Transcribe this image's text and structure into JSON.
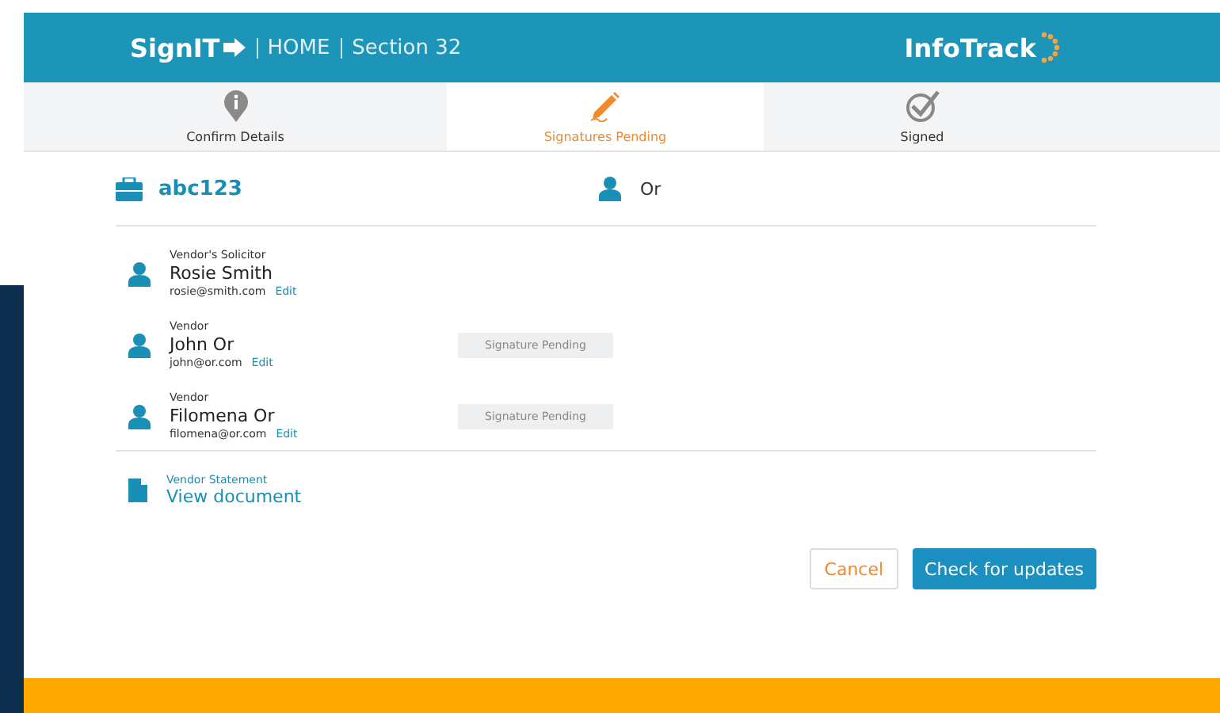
{
  "header": {
    "brand": "SignIT",
    "nav": [
      {
        "label": "HOME"
      },
      {
        "label": "Section 32"
      }
    ],
    "logo": "InfoTrack"
  },
  "tabs": [
    {
      "label": "Confirm Details",
      "selected": false,
      "kind": "info"
    },
    {
      "label": "Signatures Pending",
      "selected": true,
      "kind": "pen"
    },
    {
      "label": "Signed",
      "selected": false,
      "kind": "check"
    }
  ],
  "matter": {
    "reference": "abc123",
    "client": "Or"
  },
  "parties": [
    {
      "role": "Vendor's Solicitor",
      "name": "Rosie Smith",
      "email": "rosie@smith.com",
      "action": "Edit"
    },
    {
      "role": "Vendor",
      "name": "John Or",
      "email": "john@or.com",
      "action": "Edit",
      "status": "Signature Pending"
    },
    {
      "role": "Vendor",
      "name": "Filomena Or",
      "email": "filomena@or.com",
      "action": "Edit",
      "status": "Signature Pending"
    }
  ],
  "document": {
    "label": "Vendor Statement",
    "link": "View document"
  },
  "buttons": [
    {
      "label": "Cancel",
      "kind": "secondary"
    },
    {
      "label": "Check for updates",
      "kind": "primary"
    }
  ]
}
